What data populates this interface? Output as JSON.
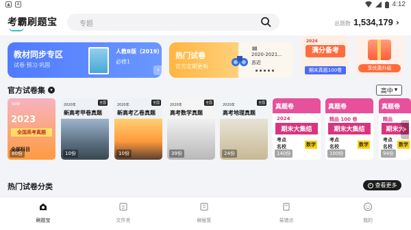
{
  "status_bar": {
    "time": "4:12"
  },
  "header": {
    "app_name": "考霸刷题宝",
    "search_placeholder": "专题",
    "total_label": "总题数",
    "total_value": "1,534,179",
    "total_arrow": "›"
  },
  "banners": {
    "textbook": {
      "title": "教材同步专区",
      "subtitle": "试卷·预习·巩固",
      "edition": "人教B版（2019）",
      "volume": "必修1"
    },
    "hot_papers": {
      "title": "热门试卷",
      "subtitle": "官方定期更新",
      "paper_line1": "2020-2021...",
      "paper_line2": "苏近"
    },
    "final_exam": {
      "year": "2024",
      "big": "满分备考",
      "sub": "期末真题100卷"
    },
    "discount": {
      "label": "享优惠升级"
    }
  },
  "official_papers": {
    "title": "官方试卷集",
    "level": "高中",
    "cards": [
      {
        "tag": "NEW",
        "year": "2023",
        "name": "全国高考真题",
        "footer": "全部科目",
        "count": "80份"
      },
      {
        "tag": "全国",
        "year": "2020年",
        "name": "新高考甲卷真题",
        "count": "10份"
      },
      {
        "tag": "全国",
        "year": "2020年",
        "name": "新高考乙卷真题",
        "count": "10份"
      },
      {
        "tag": "全国",
        "year": "2020年",
        "name": "高考数学真题",
        "count": "39份"
      },
      {
        "tag": "全国",
        "year": "2020年",
        "name": "高考地理真题",
        "count": "24份"
      },
      {
        "head": "真题卷",
        "year": "2024",
        "big": "期末大集结",
        "sub1": "考点",
        "sub2": "名校",
        "subject": "数学",
        "count": "140份"
      },
      {
        "head": "真题卷",
        "year": "精品 100 卷",
        "big": "期末大集结",
        "sub1": "考点",
        "sub2": "名校",
        "subject": "数学",
        "count": "100份"
      },
      {
        "head": "真题卷",
        "year": "精品",
        "big": "期末大",
        "sub1": "考点",
        "sub2": "名校",
        "subject": "数学",
        "count": "94份"
      }
    ]
  },
  "hot_categories": {
    "title": "热门试卷分类",
    "more_label": "查看更多"
  },
  "nav": {
    "items": [
      {
        "label": "刷题宝"
      },
      {
        "label": "文件夹"
      },
      {
        "label": "刷秘笈"
      },
      {
        "label": "易错点"
      },
      {
        "label": "我的"
      }
    ]
  }
}
